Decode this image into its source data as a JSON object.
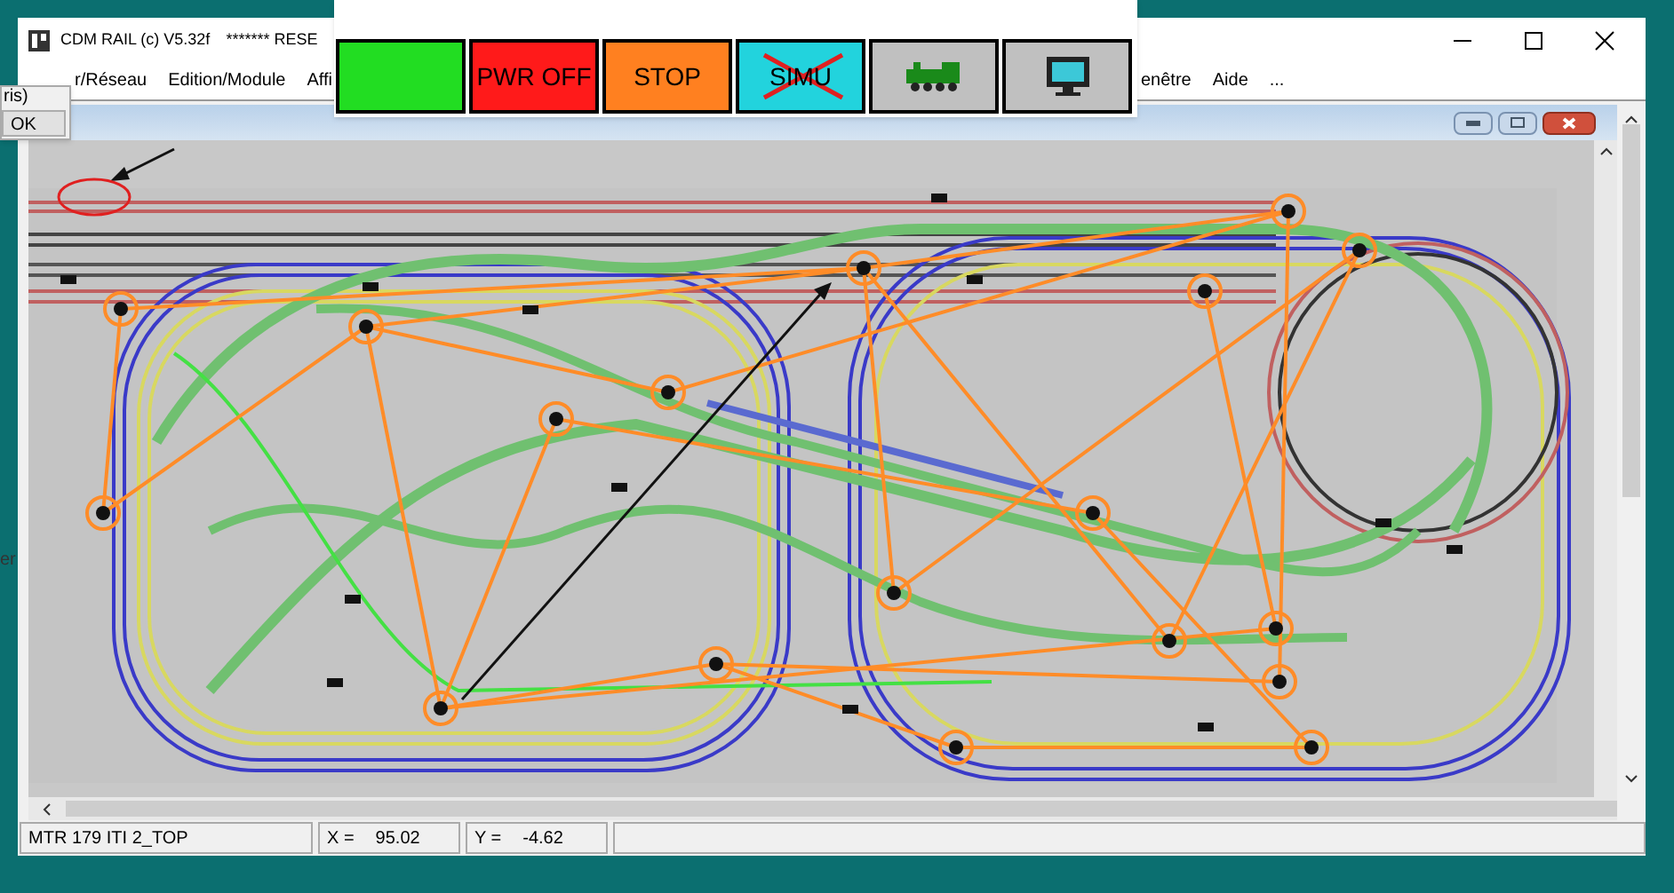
{
  "window": {
    "title": "CDM RAIL (c) V5.32f",
    "title_tail": "******* RESE"
  },
  "menu_left": [
    {
      "label": "r/Réseau"
    },
    {
      "label": "Edition/Module"
    },
    {
      "label": "Affi"
    }
  ],
  "menu_right": [
    {
      "label": "enêtre"
    },
    {
      "label": "Aide"
    },
    {
      "label": "..."
    }
  ],
  "toolbar": [
    {
      "kind": "blank",
      "color": "#22dd22"
    },
    {
      "kind": "text",
      "label": "PWR OFF",
      "color": "#ff1a1a"
    },
    {
      "kind": "text",
      "label": "STOP",
      "color": "#ff8020"
    },
    {
      "kind": "crossed",
      "label": "SIMU",
      "color": "#22d3dd"
    },
    {
      "kind": "locomotive",
      "color": "#c0c0c0"
    },
    {
      "kind": "monitor",
      "color": "#c0c0c0"
    }
  ],
  "dialog": {
    "text": "ris)",
    "button": "OK"
  },
  "side_text": "er",
  "status_bar": {
    "message": "MTR 179 ITI 2_TOP",
    "x_label": "X =",
    "x_value": "95.02",
    "y_label": "Y =",
    "y_value": "-4.62"
  }
}
